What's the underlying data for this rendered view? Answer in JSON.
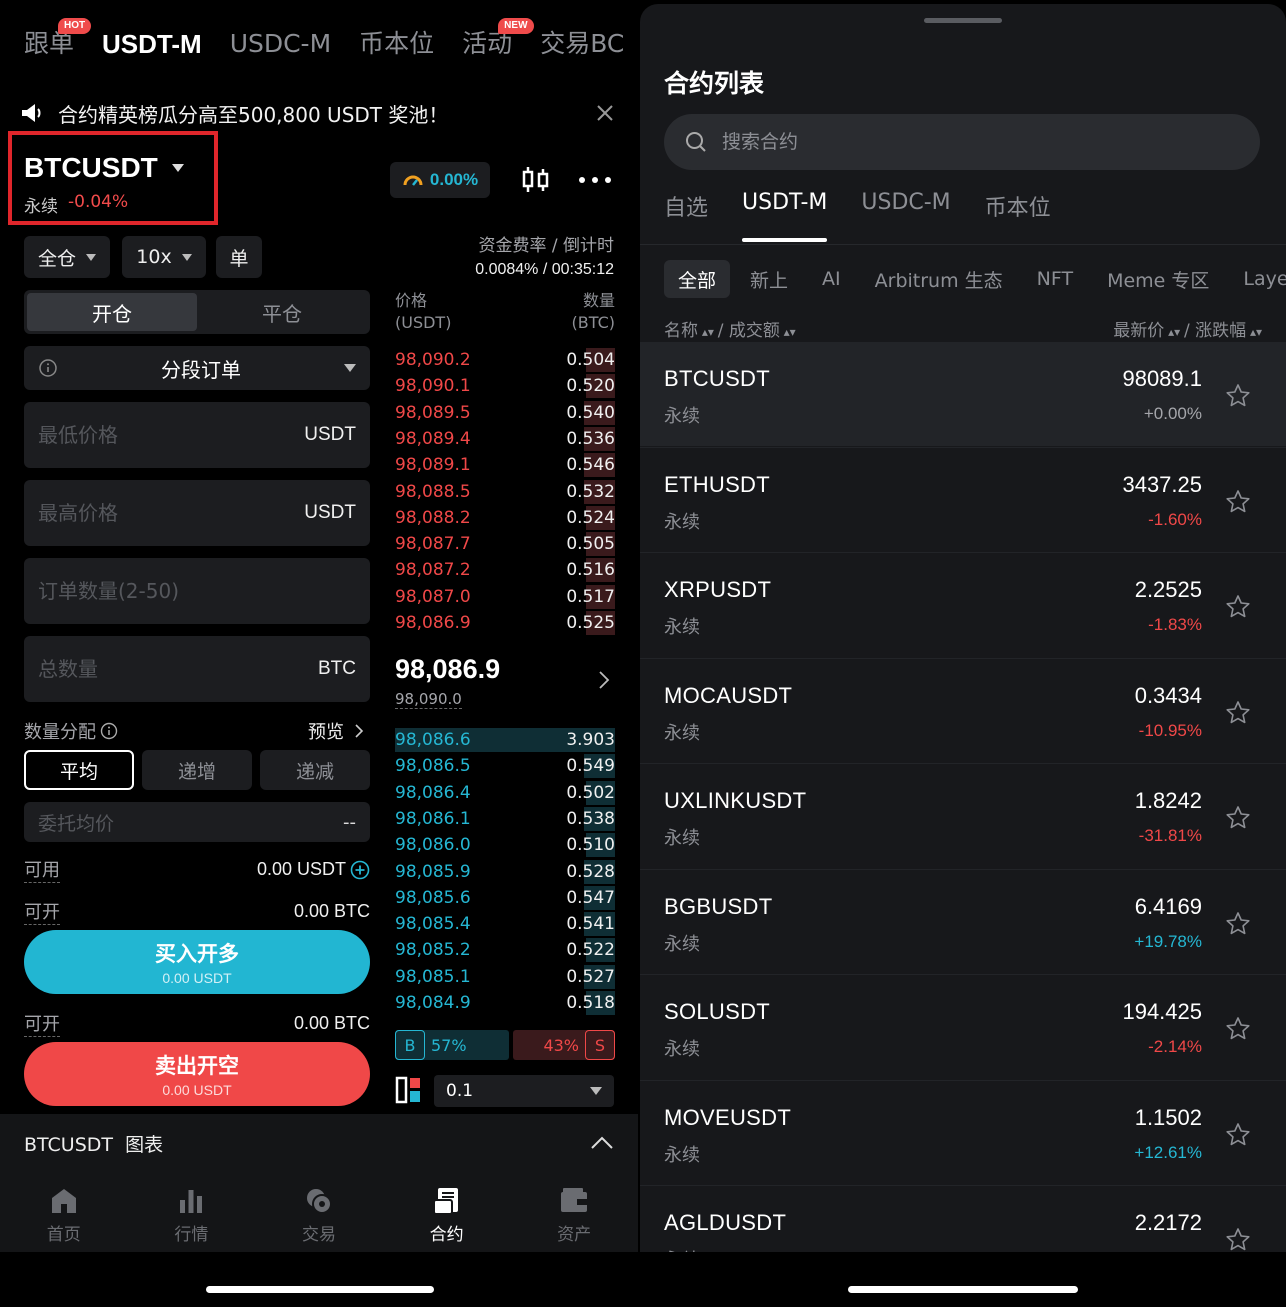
{
  "left": {
    "top_tabs": [
      {
        "label": "跟单",
        "tag": "HOT"
      },
      {
        "label": "USDT-M",
        "tag": ""
      },
      {
        "label": "USDC-M",
        "tag": ""
      },
      {
        "label": "币本位",
        "tag": ""
      },
      {
        "label": "活动",
        "tag": "NEW"
      },
      {
        "label": "交易BC",
        "tag": ""
      }
    ],
    "banner": "合约精英榜瓜分高至500,800 USDT 奖池！",
    "symbol": "BTCUSDT",
    "perp_label": "永续",
    "change": "-0.04%",
    "funding_badge": "0.00%",
    "margin_mode": "全仓",
    "leverage": "10x",
    "position_mode": "单",
    "funding_label": "资金费率 / 倒计时",
    "funding_value": "0.0084% / 00:35:12",
    "seg": {
      "open": "开仓",
      "close": "平仓"
    },
    "order_type": "分段订单",
    "low_price": {
      "placeholder": "最低价格",
      "unit": "USDT"
    },
    "high_price": {
      "placeholder": "最高价格",
      "unit": "USDT"
    },
    "order_count": {
      "placeholder": "订单数量(2-50)"
    },
    "total_qty": {
      "placeholder": "总数量",
      "unit": "BTC"
    },
    "distribution_label": "数量分配",
    "preview_label": "预览",
    "distribution": [
      "平均",
      "递增",
      "递减"
    ],
    "avg_price": {
      "label": "委托均价",
      "value": "--"
    },
    "available": {
      "label": "可用",
      "value": "0.00 USDT"
    },
    "can_open_long": {
      "label": "可开",
      "value": "0.00 BTC"
    },
    "buy_button": {
      "title": "买入开多",
      "sub": "0.00 USDT"
    },
    "can_open_short": {
      "label": "可开",
      "value": "0.00 BTC"
    },
    "sell_button": {
      "title": "卖出开空",
      "sub": "0.00 USDT"
    },
    "orderbook": {
      "price_header": "价格",
      "price_unit": "(USDT)",
      "qty_header": "数量",
      "qty_unit": "(BTC)",
      "asks": [
        {
          "p": "98,090.2",
          "q": "0.504",
          "depth": 0.13
        },
        {
          "p": "98,090.1",
          "q": "0.520",
          "depth": 0.13
        },
        {
          "p": "98,089.5",
          "q": "0.540",
          "depth": 0.14
        },
        {
          "p": "98,089.4",
          "q": "0.536",
          "depth": 0.14
        },
        {
          "p": "98,089.1",
          "q": "0.546",
          "depth": 0.14
        },
        {
          "p": "98,088.5",
          "q": "0.532",
          "depth": 0.14
        },
        {
          "p": "98,088.2",
          "q": "0.524",
          "depth": 0.13
        },
        {
          "p": "98,087.7",
          "q": "0.505",
          "depth": 0.13
        },
        {
          "p": "98,087.2",
          "q": "0.516",
          "depth": 0.13
        },
        {
          "p": "98,087.0",
          "q": "0.517",
          "depth": 0.13
        },
        {
          "p": "98,086.9",
          "q": "0.525",
          "depth": 0.13
        }
      ],
      "mid_price": "98,086.9",
      "mark_price": "98,090.0",
      "bids": [
        {
          "p": "98,086.6",
          "q": "3.903",
          "depth": 1.0
        },
        {
          "p": "98,086.5",
          "q": "0.549",
          "depth": 0.14
        },
        {
          "p": "98,086.4",
          "q": "0.502",
          "depth": 0.13
        },
        {
          "p": "98,086.1",
          "q": "0.538",
          "depth": 0.14
        },
        {
          "p": "98,086.0",
          "q": "0.510",
          "depth": 0.13
        },
        {
          "p": "98,085.9",
          "q": "0.528",
          "depth": 0.14
        },
        {
          "p": "98,085.6",
          "q": "0.547",
          "depth": 0.14
        },
        {
          "p": "98,085.4",
          "q": "0.541",
          "depth": 0.14
        },
        {
          "p": "98,085.2",
          "q": "0.522",
          "depth": 0.13
        },
        {
          "p": "98,085.1",
          "q": "0.527",
          "depth": 0.14
        },
        {
          "p": "98,084.9",
          "q": "0.518",
          "depth": 0.13
        }
      ],
      "buy_ratio": "57%",
      "sell_ratio": "43%",
      "b_label": "B",
      "s_label": "S",
      "depth_step": "0.1"
    },
    "chart_bar": "BTCUSDT  图表",
    "nav": [
      {
        "label": "首页",
        "icon": "home-icon"
      },
      {
        "label": "行情",
        "icon": "market-icon"
      },
      {
        "label": "交易",
        "icon": "trade-icon"
      },
      {
        "label": "合约",
        "icon": "futures-icon"
      },
      {
        "label": "资产",
        "icon": "wallet-icon"
      }
    ]
  },
  "right": {
    "title": "合约列表",
    "search_placeholder": "搜索合约",
    "market_tabs": [
      "自选",
      "USDT-M",
      "USDC-M",
      "币本位"
    ],
    "category_tabs": [
      "全部",
      "新上",
      "AI",
      "Arbitrum 生态",
      "NFT",
      "Meme 专区",
      "Layer"
    ],
    "list_header_left": "名称",
    "list_header_left2": "/ 成交额",
    "list_header_right": "最新价",
    "list_header_right2": "/ 涨跌幅",
    "rows": [
      {
        "symbol": "BTCUSDT",
        "perp": "永续",
        "price": "98089.1",
        "change": "+0.00%",
        "dir": "zero"
      },
      {
        "symbol": "ETHUSDT",
        "perp": "永续",
        "price": "3437.25",
        "change": "-1.60%",
        "dir": "neg"
      },
      {
        "symbol": "XRPUSDT",
        "perp": "永续",
        "price": "2.2525",
        "change": "-1.83%",
        "dir": "neg"
      },
      {
        "symbol": "MOCAUSDT",
        "perp": "永续",
        "price": "0.3434",
        "change": "-10.95%",
        "dir": "neg"
      },
      {
        "symbol": "UXLINKUSDT",
        "perp": "永续",
        "price": "1.8242",
        "change": "-31.81%",
        "dir": "neg"
      },
      {
        "symbol": "BGBUSDT",
        "perp": "永续",
        "price": "6.4169",
        "change": "+19.78%",
        "dir": "pos"
      },
      {
        "symbol": "SOLUSDT",
        "perp": "永续",
        "price": "194.425",
        "change": "-2.14%",
        "dir": "neg"
      },
      {
        "symbol": "MOVEUSDT",
        "perp": "永续",
        "price": "1.1502",
        "change": "+12.61%",
        "dir": "pos"
      },
      {
        "symbol": "AGLDUSDT",
        "perp": "永续",
        "price": "2.2172",
        "change": "",
        "dir": "neg"
      }
    ]
  }
}
